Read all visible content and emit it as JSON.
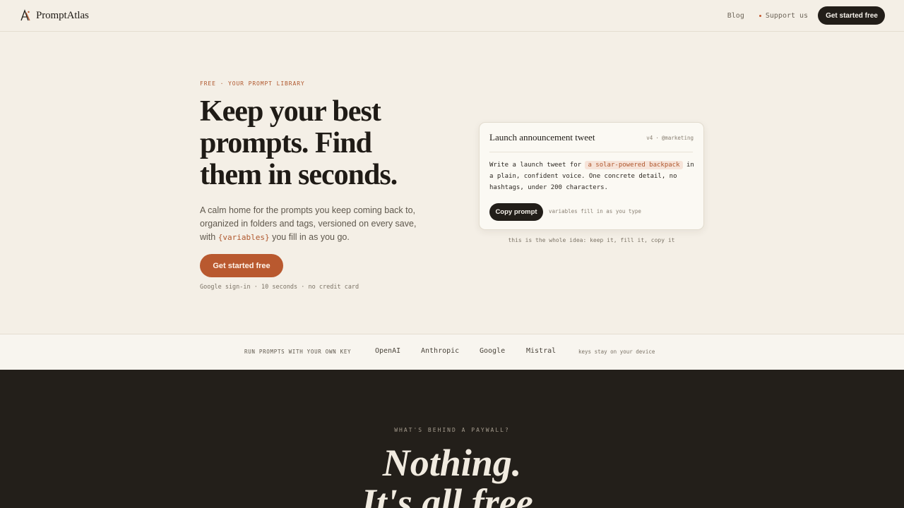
{
  "header": {
    "brand": "PromptAtlas",
    "nav": {
      "blog": "Blog",
      "support": "Support us",
      "cta": "Get started free"
    }
  },
  "hero": {
    "eyebrow": "FREE · YOUR PROMPT LIBRARY",
    "title_lines": [
      "Keep your best",
      "prompts. Find",
      "them in seconds."
    ],
    "subtitle_before": "A calm home for the prompts you keep coming back to, organized in folders and tags, versioned on every save, with",
    "subtitle_var": "{variables}",
    "subtitle_after": "you fill in as you go.",
    "cta": "Get started free",
    "note": "Google sign-in · 10 seconds · no credit card"
  },
  "card": {
    "title": "Launch announcement tweet",
    "version": "v4",
    "separator": "·",
    "tag": "@marketing",
    "body_before": "Write a launch tweet for",
    "body_var": "a solar-powered backpack",
    "body_after": "in a plain, confident voice. One concrete detail, no hashtags, under 200 characters.",
    "copy_button": "Copy prompt",
    "hint": "variables fill in as you type",
    "caption": "this is the whole idea: keep it, fill it, copy it"
  },
  "providers": {
    "label": "RUN PROMPTS WITH YOUR OWN KEY",
    "items": [
      "OpenAI",
      "Anthropic",
      "Google",
      "Mistral"
    ],
    "note": "keys stay on your device"
  },
  "paywall": {
    "eyebrow": "WHAT'S BEHIND A PAYWALL?",
    "title_lines": [
      "Nothing.",
      "It's all free."
    ]
  },
  "colors": {
    "background": "#f4efe6",
    "accent": "#b9592f",
    "dark": "#231f1a"
  }
}
